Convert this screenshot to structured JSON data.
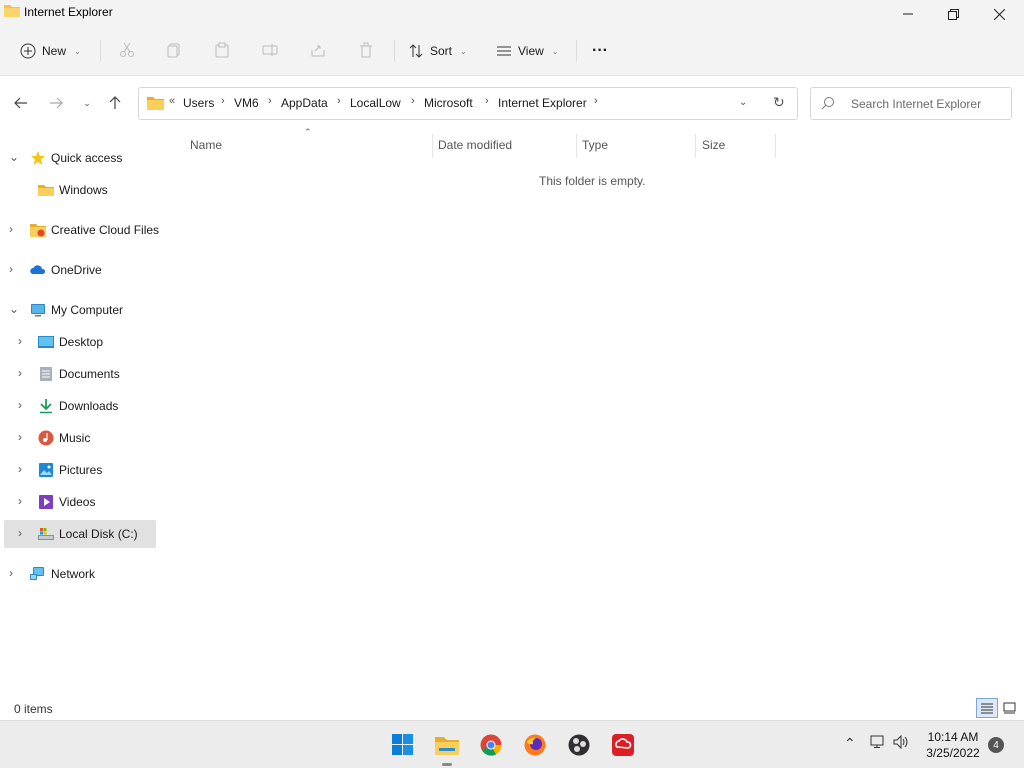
{
  "window": {
    "title": "Internet Explorer"
  },
  "toolbar": {
    "new_label": "New",
    "sort_label": "Sort",
    "view_label": "View",
    "more_label": "···",
    "icons": [
      "cut-icon",
      "copy-icon",
      "paste-icon",
      "rename-icon",
      "share-icon",
      "delete-icon"
    ]
  },
  "address": {
    "overflow": "«",
    "crumbs": [
      "Users",
      "VM6",
      "AppData",
      "LocalLow",
      "Microsoft",
      "Internet Explorer"
    ],
    "search_placeholder": "Search Internet Explorer"
  },
  "sidebar": {
    "items": [
      {
        "label": "Quick access",
        "icon": "star-icon",
        "chev": "v"
      },
      {
        "label": "Windows",
        "icon": "folder-icon",
        "chev": ""
      },
      {
        "label": "Creative Cloud Files",
        "icon": "creative-cloud-folder-icon",
        "chev": ">"
      },
      {
        "label": "OneDrive",
        "icon": "onedrive-cloud-icon",
        "chev": ">"
      },
      {
        "label": "My Computer",
        "icon": "computer-icon",
        "chev": "v"
      },
      {
        "label": "Desktop",
        "icon": "desktop-icon",
        "chev": ">"
      },
      {
        "label": "Documents",
        "icon": "documents-icon",
        "chev": ">"
      },
      {
        "label": "Downloads",
        "icon": "downloads-icon",
        "chev": ">"
      },
      {
        "label": "Music",
        "icon": "music-icon",
        "chev": ">"
      },
      {
        "label": "Pictures",
        "icon": "pictures-icon",
        "chev": ">"
      },
      {
        "label": "Videos",
        "icon": "videos-icon",
        "chev": ">"
      },
      {
        "label": "Local Disk (C:)",
        "icon": "local-disk-icon",
        "chev": ">"
      },
      {
        "label": "Network",
        "icon": "network-icon",
        "chev": ">"
      }
    ]
  },
  "content": {
    "columns": [
      "Name",
      "Date modified",
      "Type",
      "Size"
    ],
    "empty_text": "This folder is empty."
  },
  "status": {
    "items_count": "0 items"
  },
  "taskbar": {
    "apps": [
      "windows-start-icon",
      "file-explorer-icon",
      "chrome-icon",
      "firefox-icon",
      "obs-icon",
      "creative-cloud-icon"
    ],
    "time": "10:14 AM",
    "date": "3/25/2022",
    "notifications": "4"
  },
  "colors": {
    "accent": "#0067c0",
    "folder": "#f4c24b",
    "selection": "#e1e1e1"
  }
}
